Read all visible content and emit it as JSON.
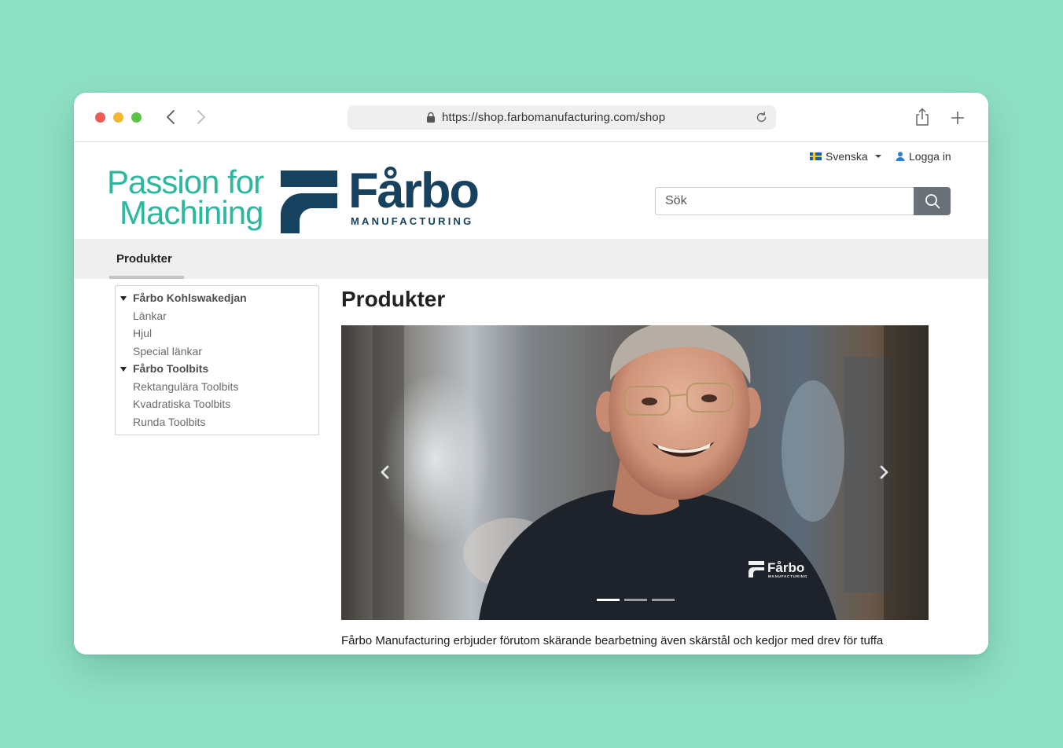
{
  "browser": {
    "url": "https://shop.farbomanufacturing.com/shop"
  },
  "topbar": {
    "language": "Svenska",
    "login": "Logga in"
  },
  "brand": {
    "tagline_line1": "Passion for",
    "tagline_line2": "Machining",
    "logo_word": "Fårbo",
    "logo_sub": "MANUFACTURING",
    "shirt_logo_word": "Fårbo",
    "shirt_logo_sub": "MANUFACTURING"
  },
  "search": {
    "placeholder": "Sök"
  },
  "menu": {
    "active_tab": "Produkter"
  },
  "sidebar": {
    "categories": [
      {
        "label": "Fårbo Kohlswakedjan",
        "children": [
          "Länkar",
          "Hjul",
          "Special länkar"
        ]
      },
      {
        "label": "Fårbo Toolbits",
        "children": [
          "Rektangulära Toolbits",
          "Kvadratiska Toolbits",
          "Runda Toolbits"
        ]
      }
    ]
  },
  "main": {
    "title": "Produkter",
    "intro": "Fårbo Manufacturing erbjuder förutom skärande bearbetning även skärstål och kedjor med drev för tuffa"
  },
  "carousel": {
    "slide_count": 3,
    "active_index": 0
  },
  "colors": {
    "background": "#8ee0c4",
    "brand_navy": "#17425f",
    "tagline_teal": "#2bb89e",
    "search_button": "#6b7178"
  },
  "icons": {
    "back": "chevron-left-icon",
    "forward": "chevron-right-icon",
    "lock": "lock-icon",
    "reload": "reload-icon",
    "share": "share-icon",
    "new_tab": "plus-icon",
    "search": "magnifier-icon",
    "user": "user-icon"
  }
}
